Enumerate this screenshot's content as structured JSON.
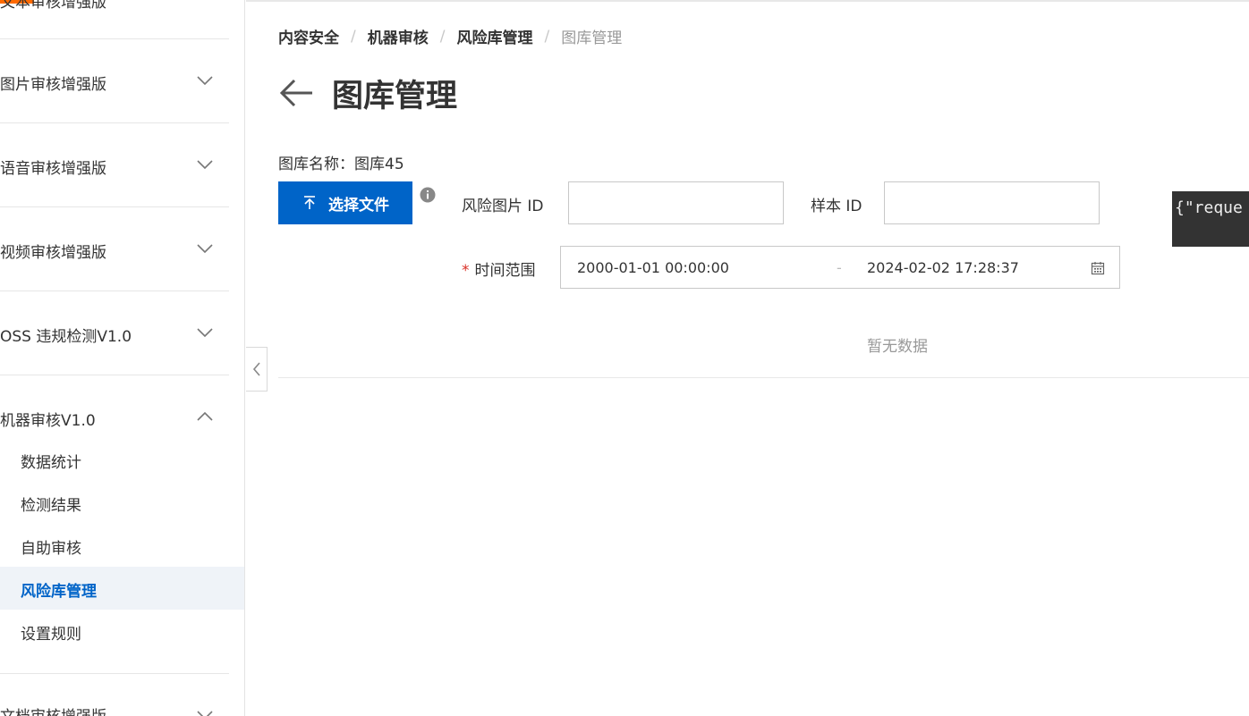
{
  "sidebar": {
    "top_cut_label": "文本审核增强版",
    "groups": [
      {
        "label": "图片审核增强版"
      },
      {
        "label": "语音审核增强版"
      },
      {
        "label": "视频审核增强版"
      },
      {
        "label": "OSS 违规检测V1.0"
      }
    ],
    "open_group": {
      "label": "机器审核V1.0",
      "items": [
        {
          "label": "数据统计"
        },
        {
          "label": "检测结果"
        },
        {
          "label": "自助审核"
        },
        {
          "label": "风险库管理",
          "active": true
        },
        {
          "label": "设置规则"
        }
      ]
    },
    "bottom_cut_label": "文档审核增强版"
  },
  "breadcrumb": [
    "内容安全",
    "机器审核",
    "风险库管理",
    "图库管理"
  ],
  "page": {
    "title": "图库管理",
    "library_name_label": "图库名称：",
    "library_name_value": "图库45"
  },
  "filters": {
    "upload_label": "选择文件",
    "risk_image_id_label": "风险图片 ID",
    "risk_image_id_value": "",
    "sample_id_label": "样本 ID",
    "sample_id_value": "",
    "time_range_label": "时间范围",
    "time_range_start": "2000-01-01 00:00:00",
    "time_range_sep": "-",
    "time_range_end": "2024-02-02 17:28:37"
  },
  "empty_text": "暂无数据",
  "tooltip_text": "{\"reque",
  "colors": {
    "primary": "#0064c8",
    "accent": "#ff6a00",
    "active_bg": "#eff3f8",
    "required": "#d93026"
  },
  "icons": [
    "chevron-down-icon",
    "chevron-up-icon",
    "chevron-left-icon",
    "arrow-left-icon",
    "upload-icon",
    "info-icon",
    "calendar-icon"
  ]
}
